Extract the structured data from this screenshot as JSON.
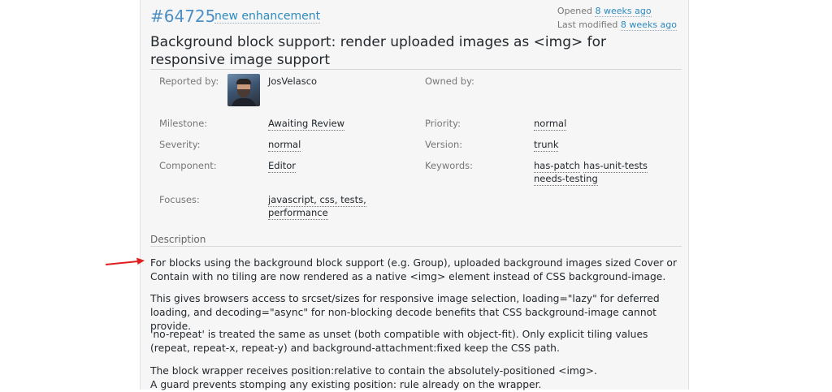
{
  "ticket": {
    "id": "#64725",
    "type": "new enhancement",
    "opened_label": "Opened",
    "opened_value": "8 weeks ago",
    "modified_label": "Last modified",
    "modified_value": "8 weeks ago",
    "summary": "Background block support: render uploaded images as <img> for responsive image support"
  },
  "properties": {
    "reported_by_label": "Reported by:",
    "reported_by_value": "JosVelasco",
    "owned_by_label": "Owned by:",
    "milestone_label": "Milestone:",
    "milestone_value": "Awaiting Review",
    "priority_label": "Priority:",
    "priority_value": "normal",
    "severity_label": "Severity:",
    "severity_value": "normal",
    "version_label": "Version:",
    "version_value": "trunk",
    "component_label": "Component:",
    "component_value": "Editor",
    "keywords_label": "Keywords:",
    "keywords": [
      "has-patch",
      "has-unit-tests",
      "needs-testing"
    ],
    "focuses_label": "Focuses:",
    "focuses_line1": "javascript, css, tests,",
    "focuses_line2": "performance"
  },
  "description": {
    "heading": "Description",
    "paragraphs": [
      "For blocks using the background block support (e.g. Group), uploaded background images sized Cover or Contain with no tiling are now rendered as a native <img> element instead of CSS background-image.",
      "This gives browsers access to srcset/sizes for responsive image selection, loading=\"lazy\" for deferred loading, and decoding=\"async\" for non-blocking decode benefits that CSS background-image cannot provide.",
      "'no-repeat' is treated the same as unset (both compatible with object-fit). Only explicit tiling values (repeat, repeat-x, repeat-y) and background-attachment:fixed keep the CSS path.",
      "The block wrapper receives position:relative to contain the absolutely-positioned <img>.",
      "A guard prevents stomping any existing position: rule already on the wrapper."
    ]
  },
  "colors": {
    "link": "#2d8bc0",
    "arrow": "#e02020",
    "panel_bg": "#f6f6f6"
  }
}
